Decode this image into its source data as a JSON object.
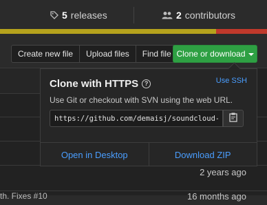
{
  "repo_stats": {
    "releases_count": "5",
    "releases_label": "releases",
    "contributors_count": "2",
    "contributors_label": "contributors"
  },
  "language_bar": [
    {
      "color": "#b5a21c",
      "fraction": 0.81
    },
    {
      "color": "#c0392b",
      "fraction": 0.19
    }
  ],
  "file_actions": {
    "create_new_file": "Create new file",
    "upload_files": "Upload files",
    "find_file": "Find file",
    "clone_or_download": "Clone or download"
  },
  "clone_popup": {
    "title": "Clone with HTTPS",
    "use_ssh": "Use SSH",
    "description": "Use Git or checkout with SVN using the web URL.",
    "url": "https://github.com/demaisj/soundcloud-rp",
    "open_in_desktop": "Open in Desktop",
    "download_zip": "Download ZIP"
  },
  "file_rows": [
    {
      "age": "2 years ago"
    },
    {
      "commit_fragment": "th. Fixes #10",
      "age": "16 months ago"
    }
  ],
  "colors": {
    "accent_link": "#4a9eff",
    "clone_button": "#2ea043"
  },
  "icons": [
    "tag-icon",
    "people-icon",
    "help-icon",
    "clipboard-icon",
    "caret-down-icon"
  ]
}
